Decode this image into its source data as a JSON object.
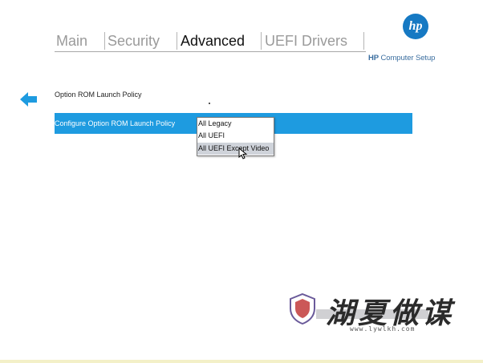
{
  "tabs": [
    {
      "label": "Main",
      "active": false
    },
    {
      "label": "Security",
      "active": false
    },
    {
      "label": "Advanced",
      "active": true
    },
    {
      "label": "UEFI Drivers",
      "active": false
    }
  ],
  "brand": {
    "logo_text": "hp",
    "subtitle_bold": "HP",
    "subtitle_rest": " Computer Setup",
    "color": "#1679c3"
  },
  "page": {
    "section_title": "Option ROM Launch Policy",
    "back_icon": "arrow-left-icon"
  },
  "setting": {
    "label": "Configure Option ROM Launch Policy",
    "highlight_color": "#1e9be0"
  },
  "dropdown": {
    "options": [
      "All Legacy",
      "All UEFI",
      "All UEFI Except Video"
    ],
    "hovered_option": "All UEFI Except Video"
  },
  "watermark": {
    "text": "湖夏做谋",
    "url": "www.lywlkh.com"
  }
}
